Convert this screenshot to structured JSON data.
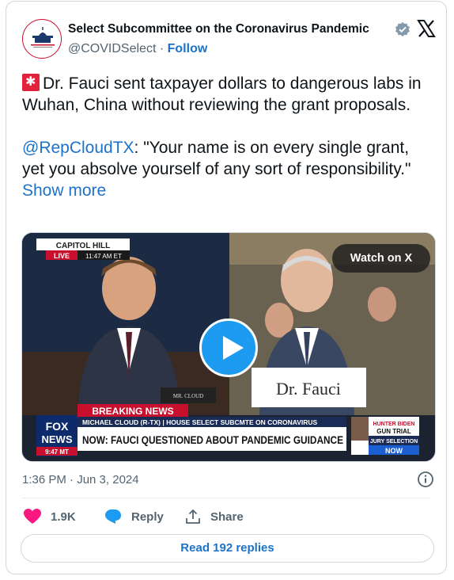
{
  "author": {
    "display_name": "Select Subcommittee on the Coronavirus Pandemic",
    "handle": "@COVIDSelect",
    "separator": "·",
    "follow_label": "Follow"
  },
  "tweet": {
    "line1": "Dr. Fauci sent taxpayer dollars to dangerous labs in Wuhan, China without reviewing the grant proposals.",
    "mention": "@RepCloudTX",
    "quote": ": \"Your name is on every single grant, yet you absolve yourself of any sort of responsibility.\"",
    "show_more": "Show more"
  },
  "media": {
    "watch_label": "Watch on X",
    "location_tag": "CAPITOL HILL",
    "live_tag": "LIVE",
    "live_time": "11:47 AM ET",
    "nameplate_left": "MR. CLOUD",
    "nameplate_right": "Dr. Fauci",
    "breaking_label": "BREAKING NEWS",
    "lower_third_sub": "MICHAEL CLOUD (R-TX) | HOUSE SELECT SUBCMTE ON CORONAVIRUS",
    "headline": "NOW: FAUCI QUESTIONED ABOUT PANDEMIC GUIDANCE",
    "network_top": "FOX",
    "network_bottom": "NEWS",
    "network_time": "9:47 MT",
    "side_promo_line1": "HUNTER BIDEN",
    "side_promo_line2": "GUN TRIAL",
    "side_promo_line3": "JURY SELECTION",
    "side_promo_line4": "NOW"
  },
  "meta": {
    "timestamp": "1:36 PM · Jun 3, 2024"
  },
  "actions": {
    "likes": "1.9K",
    "reply_label": "Reply",
    "share_label": "Share"
  },
  "read_replies_label": "Read 192 replies",
  "colors": {
    "link": "#1d72c9",
    "heart": "#f91880",
    "play": "#1d9bf0"
  }
}
